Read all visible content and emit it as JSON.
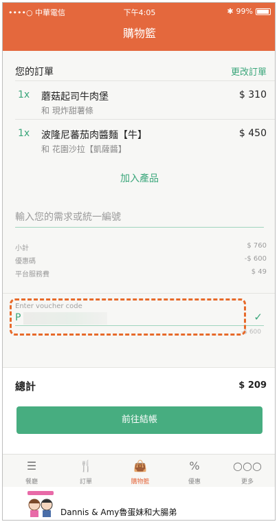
{
  "status": {
    "carrier": "••••○ 中華電信",
    "wifi_icon": "wifi-icon",
    "time": "下午4:05",
    "bluetooth": "✱",
    "battery": "99%"
  },
  "nav": {
    "title": "購物籃"
  },
  "order": {
    "title": "您的訂單",
    "edit_label": "更改訂單",
    "items": [
      {
        "qty": "1x",
        "name": "蘑菇起司牛肉堡",
        "sub": "和 現炸甜薯條",
        "price": "$ 310"
      },
      {
        "qty": "1x",
        "name": "波隆尼蕃茄肉醬麵【牛】",
        "sub": "和 花園沙拉【凱薩醬】",
        "price": "$ 450"
      }
    ],
    "add_label": "加入產品",
    "note_placeholder": "輸入您的需求或統一編號",
    "summary": [
      {
        "label": "小計",
        "value": "$ 760"
      },
      {
        "label": "優惠碼",
        "value": "-$ 600"
      },
      {
        "label": "平台服務費",
        "value": "$ 49"
      }
    ]
  },
  "voucher": {
    "label": "Enter voucher code",
    "value": "P",
    "check_icon": "✓",
    "faint": "-$ 600"
  },
  "total": {
    "label": "總計",
    "value": "$ 209"
  },
  "checkout": {
    "label": "前往結帳"
  },
  "tabs": [
    {
      "label": "餐廳",
      "icon": "list-icon",
      "glyph": "☰"
    },
    {
      "label": "訂單",
      "icon": "fork-knife-icon",
      "glyph": "🍴"
    },
    {
      "label": "購物籃",
      "icon": "bag-icon",
      "glyph": "👜"
    },
    {
      "label": "優惠",
      "icon": "percent-icon",
      "glyph": "%"
    },
    {
      "label": "更多",
      "icon": "more-icon",
      "glyph": "○○○"
    }
  ],
  "footer": {
    "brand": "Dannis & Amy魯蛋妹和大腸弟"
  },
  "colors": {
    "accent": "#e4683d",
    "green": "#47ad80",
    "dash": "#e76a2a"
  }
}
